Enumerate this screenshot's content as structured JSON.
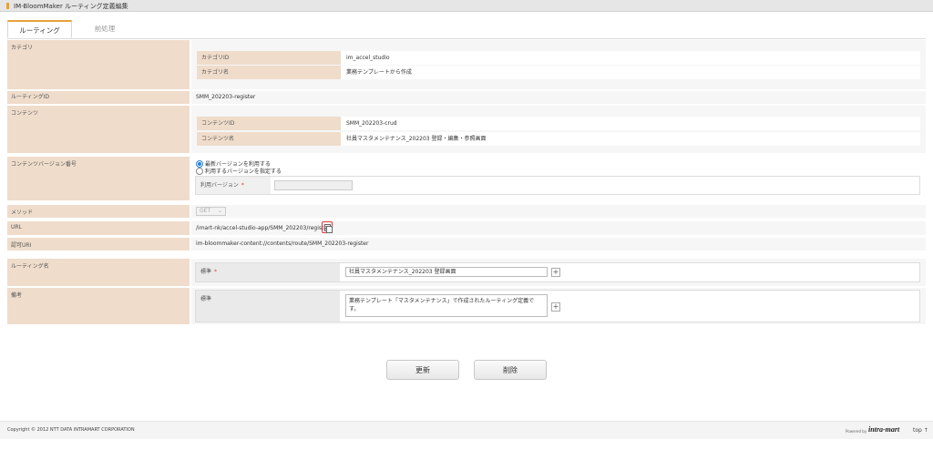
{
  "title": "IM-BloomMaker ルーティング定義編集",
  "tabs": [
    {
      "label": "ルーティング"
    },
    {
      "label": "前処理"
    }
  ],
  "category": {
    "label": "カテゴリ",
    "id_label": "カテゴリID",
    "id_value": "im_accel_studio",
    "name_label": "カテゴリ名",
    "name_value": "業務テンプレートから作成"
  },
  "routing_id": {
    "label": "ルーティングID",
    "value": "SMM_202203-register"
  },
  "contents": {
    "label": "コンテンツ",
    "id_label": "コンテンツID",
    "id_value": "SMM_202203-crud",
    "name_label": "コンテンツ名",
    "name_value": "社員マスタメンテナンス_202203 登録・編集・参照画面"
  },
  "content_version": {
    "label": "コンテンツバージョン番号",
    "option_latest": "最新バージョンを利用する",
    "option_specify": "利用するバージョンを指定する",
    "use_version_label": "利用バージョン",
    "required_mark": "*",
    "use_version_value": ""
  },
  "method": {
    "label": "メソッド",
    "value": "GET"
  },
  "url": {
    "label": "URL",
    "value": "/imart-nk/accel-studio-app/SMM_202203/register"
  },
  "auth_uri": {
    "label": "認可URI",
    "value": "im-bloommaker-content://contents/route/SMM_202203-register"
  },
  "routing_name": {
    "label": "ルーティング名",
    "locale_label": "標準",
    "required_mark": "*",
    "value": "社員マスタメンテナンス_202203 登録画面"
  },
  "remarks": {
    "label": "備考",
    "locale_label": "標準",
    "value": "業務テンプレート「マスタメンテナンス」で作成されたルーティング定義です。"
  },
  "buttons": {
    "update": "更新",
    "delete": "削除"
  },
  "footer": {
    "copyright": "Copyright © 2012 NTT DATA INTRAMART CORPORATION",
    "powered_by": "Powered by",
    "brand": "intra-mart",
    "top_link": "top ↑"
  },
  "icons": {
    "copy": "copy-icon",
    "plus": "plus-icon",
    "chevron": "chevron-down-icon"
  },
  "colors": {
    "accent": "#e8a23a",
    "label_bg": "#efdccb",
    "highlight": "#e23b3b"
  }
}
